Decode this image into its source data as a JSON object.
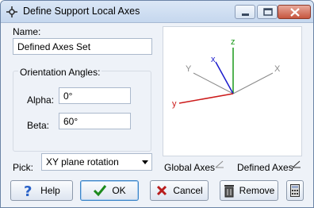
{
  "window": {
    "title": "Define Support Local Axes"
  },
  "titlebar": {
    "minimize_icon": "minimize-icon",
    "maximize_icon": "maximize-icon",
    "close_icon": "close-icon"
  },
  "form": {
    "name_label": "Name:",
    "name_value": "Defined Axes Set",
    "orientation_label": "Orientation Angles:",
    "alpha_label": "Alpha:",
    "alpha_value": "0°",
    "beta_label": "Beta:",
    "beta_value": "60°",
    "pick_label": "Pick:",
    "pick_value": "XY plane rotation"
  },
  "preview": {
    "global_axes": [
      "X",
      "Y",
      "Z"
    ],
    "defined_axes": [
      "x",
      "y",
      "z"
    ],
    "colors": {
      "global": "#8a8a8a",
      "x": "#1a1acc",
      "y": "#cc1a1a",
      "z": "#1a9a1a"
    },
    "global_legend": "Global Axes",
    "defined_legend": "Defined Axes"
  },
  "buttons": {
    "help": "Help",
    "ok": "OK",
    "cancel": "Cancel",
    "remove": "Remove",
    "calculator_icon": "calculator-icon"
  }
}
